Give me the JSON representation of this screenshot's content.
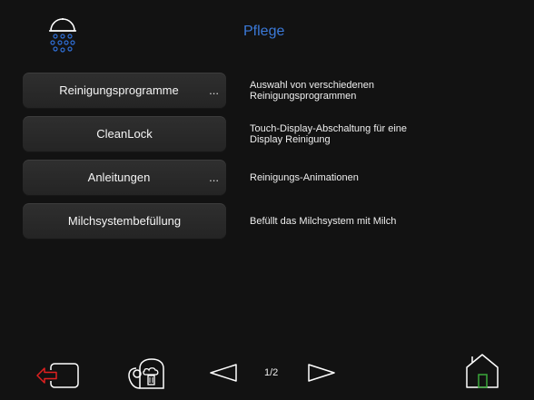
{
  "header": {
    "title": "Pflege",
    "icon": "shower-icon"
  },
  "menu": [
    {
      "label": "Reinigungsprogramme",
      "more": "...",
      "description_line1": "Auswahl von verschiedenen",
      "description_line2": "Reinigungsprogrammen"
    },
    {
      "label": "CleanLock",
      "more": "",
      "description_line1": "Touch-Display-Abschaltung für eine",
      "description_line2": "Display Reinigung"
    },
    {
      "label": "Anleitungen",
      "more": "...",
      "description_line1": "Reinigungs-Animationen",
      "description_line2": ""
    },
    {
      "label": "Milchsystembefüllung",
      "more": "",
      "description_line1": "Befüllt das Milchsystem mit Milch",
      "description_line2": ""
    }
  ],
  "footer": {
    "page_indicator": "1/2",
    "icons": [
      "exit-icon",
      "cup-steam-icon",
      "previous-arrow-icon",
      "next-arrow-icon",
      "home-icon"
    ]
  },
  "colors": {
    "background": "#121212",
    "title": "#3b79d8",
    "exit_arrow": "#e02020",
    "home_door": "#3aa83a"
  }
}
